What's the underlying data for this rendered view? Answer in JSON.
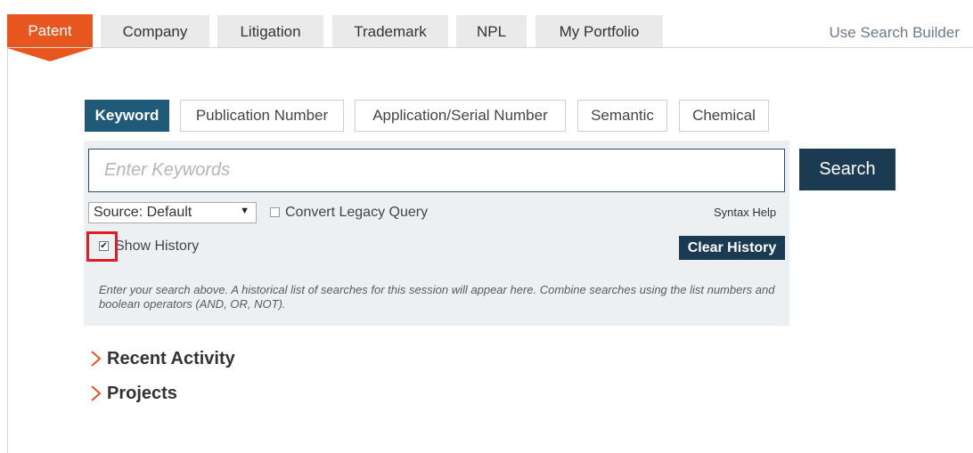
{
  "nav": {
    "tabs": [
      {
        "label": "Patent",
        "active": true
      },
      {
        "label": "Company"
      },
      {
        "label": "Litigation"
      },
      {
        "label": "Trademark"
      },
      {
        "label": "NPL"
      },
      {
        "label": "My Portfolio"
      }
    ],
    "builder_link": "Use Search Builder"
  },
  "search_types": [
    {
      "label": "Keyword",
      "active": true
    },
    {
      "label": "Publication Number"
    },
    {
      "label": "Application/Serial Number"
    },
    {
      "label": "Semantic"
    },
    {
      "label": "Chemical"
    }
  ],
  "search": {
    "placeholder": "Enter Keywords",
    "value": "",
    "button_label": "Search",
    "source_label": "Source: Default",
    "convert_legacy_label": "Convert Legacy Query",
    "convert_legacy_checked": false,
    "syntax_help": "Syntax Help",
    "show_history_label": "Show History",
    "show_history_checked": true,
    "clear_history_label": "Clear History",
    "help_text": "Enter your search above. A historical list of searches for this session will appear here. Combine searches using the list numbers and boolean operators (AND, OR, NOT)."
  },
  "sections": [
    {
      "label": "Recent Activity"
    },
    {
      "label": "Projects"
    }
  ],
  "colors": {
    "accent": "#e8561f",
    "primary": "#1a3b52",
    "keyword_active": "#1f5a78",
    "highlight": "#e11b24"
  }
}
